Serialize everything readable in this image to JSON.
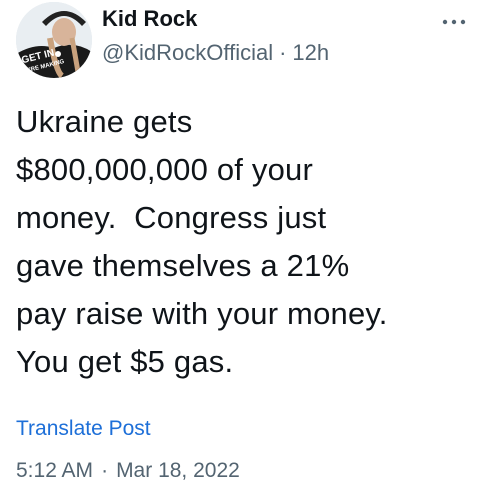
{
  "author": {
    "display_name": "Kid Rock",
    "handle": "@KidRockOfficial",
    "relative_time": "12h",
    "avatar_caption": "GET IN WE'RE MAKING"
  },
  "menu": {
    "icon": "more-horizontal-icon"
  },
  "tweet": {
    "text": "Ukraine gets\n$800,000,000 of your\nmoney.  Congress just\ngave themselves a 21%\npay raise with your money.\nYou get $5 gas."
  },
  "actions": {
    "translate_label": "Translate Post"
  },
  "footer": {
    "time": "5:12 AM",
    "separator": "·",
    "date": "Mar 18, 2022"
  },
  "colors": {
    "text_primary": "#0f1419",
    "text_secondary": "#536471",
    "link": "#1d6fd8"
  }
}
